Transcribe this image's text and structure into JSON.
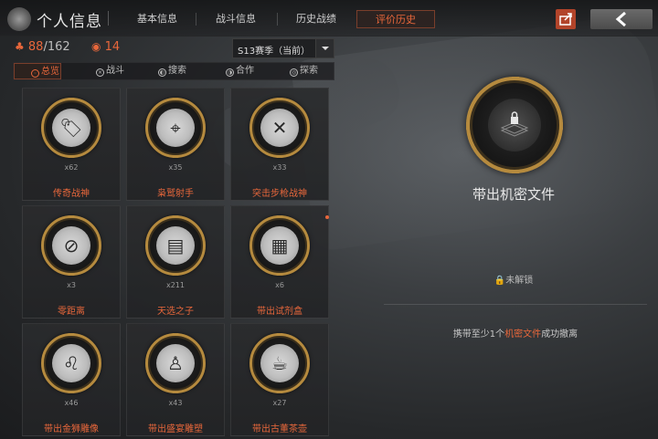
{
  "header": {
    "title": "个人信息",
    "tabs": [
      {
        "label": "基本信息",
        "active": false
      },
      {
        "label": "战斗信息",
        "active": false
      },
      {
        "label": "历史战绩",
        "active": false
      },
      {
        "label": "评价历史",
        "active": true
      }
    ]
  },
  "stats": {
    "medals_current": "88",
    "medals_total": "/162",
    "views": "14"
  },
  "season": {
    "selected": "S13赛季（当前）"
  },
  "filters": [
    {
      "label": "总览",
      "active": true
    },
    {
      "label": "战斗",
      "active": false
    },
    {
      "label": "搜索",
      "active": false
    },
    {
      "label": "合作",
      "active": false
    },
    {
      "label": "探索",
      "active": false
    }
  ],
  "achievements": [
    {
      "name": "传奇战神",
      "count": "x62",
      "icon": "dog-tags-icon",
      "glyph": "🏷"
    },
    {
      "name": "枭鹫射手",
      "count": "x35",
      "icon": "crosshair-soldier-icon",
      "glyph": "⌖"
    },
    {
      "name": "突击步枪战神",
      "count": "x33",
      "icon": "rifles-icon",
      "glyph": "✕"
    },
    {
      "name": "零距离",
      "count": "x3",
      "icon": "knife-icon",
      "glyph": "⊘"
    },
    {
      "name": "天选之子",
      "count": "x211",
      "icon": "cash-stack-icon",
      "glyph": "▤"
    },
    {
      "name": "带出试剂盒",
      "count": "x6",
      "icon": "reagent-box-icon",
      "glyph": "▦"
    },
    {
      "name": "带出金狮雕像",
      "count": "x46",
      "icon": "lion-statue-icon",
      "glyph": "♌"
    },
    {
      "name": "带出盛宴雕塑",
      "count": "x43",
      "icon": "bust-sculpture-icon",
      "glyph": "♙"
    },
    {
      "name": "带出古董茶壶",
      "count": "x27",
      "icon": "teapot-icon",
      "glyph": "☕"
    }
  ],
  "detail": {
    "title": "带出机密文件",
    "status": "未解锁",
    "condition_prefix": "携带至少1个",
    "condition_highlight": "机密文件",
    "condition_suffix": "成功撤离",
    "icon": "locked-document-icon"
  },
  "colors": {
    "accent": "#e8673b",
    "gold": "#b58a3e",
    "share_button": "#b2442a"
  }
}
